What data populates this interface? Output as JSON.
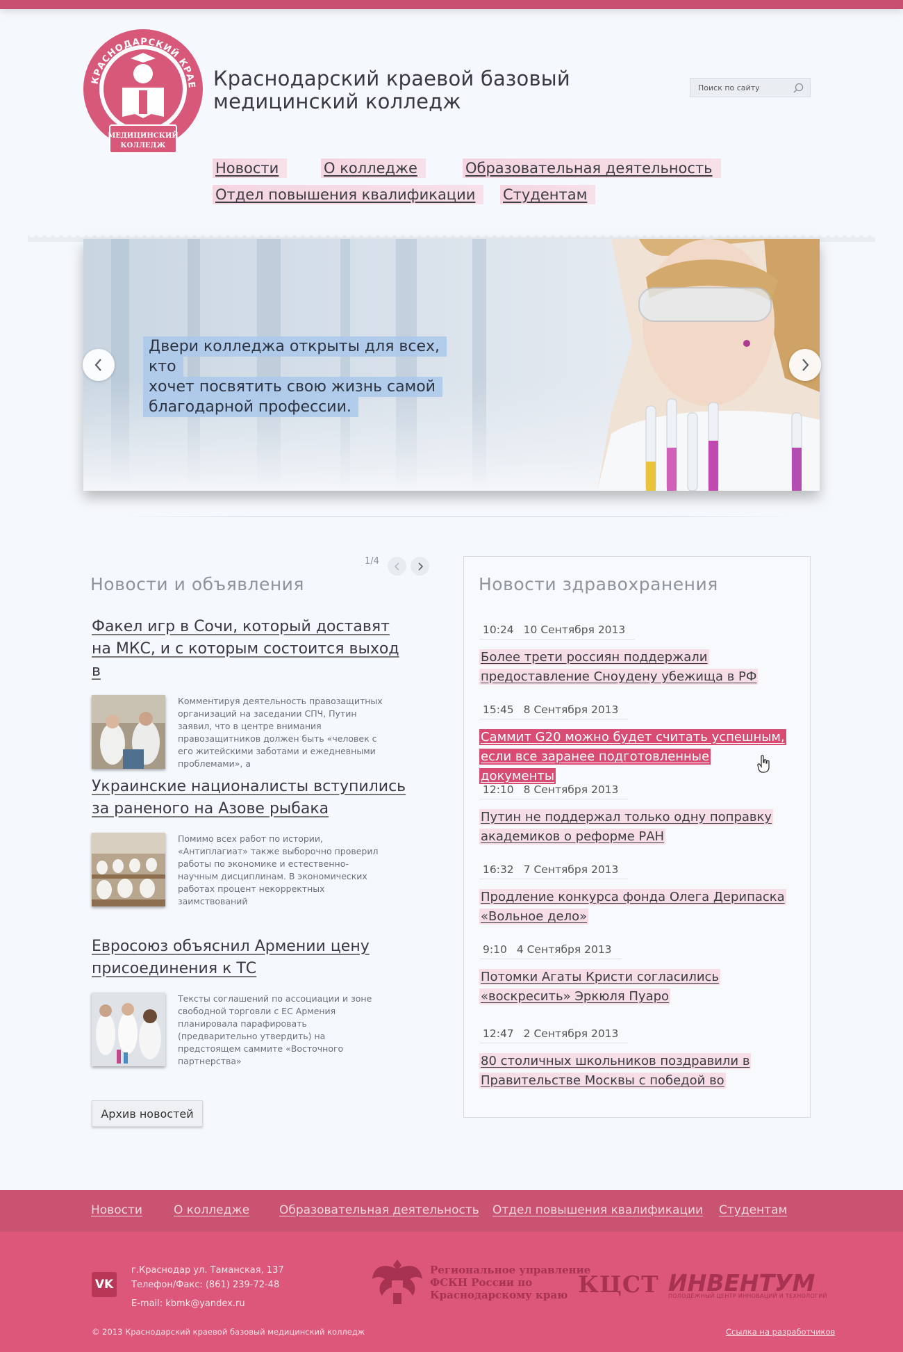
{
  "colors": {
    "accent": "#dc577a",
    "accent_dark": "#c95371",
    "highlight": "#f6dde6",
    "active": "#d84b72"
  },
  "header": {
    "title_line1": "Краснодарский краевой базовый",
    "title_line2": "медицинский колледж",
    "logo_ring_text": "КРАСНОДАРСКИЙ КРАЕВОЙ БАЗОВЫЙ",
    "logo_ribbon_line1": "МЕДИЦИНСКИЙ",
    "logo_ribbon_line2": "КОЛЛЕДЖ",
    "search_placeholder": "Поиск по сайту",
    "search_icon": "search-icon"
  },
  "nav": [
    "Новости",
    "О колледже",
    "Образовательная деятельность",
    "Отдел повышения квалификации",
    "Студентам"
  ],
  "slider": {
    "caption_line1": "Двери колледжа открыты для всех, кто",
    "caption_line2": "хочет посвятить свою жизнь самой",
    "caption_line3": "благодарной профессии.",
    "prev_icon": "chevron-left-icon",
    "next_icon": "chevron-right-icon"
  },
  "news": {
    "title": "Новости и объявления",
    "pager": "1/4",
    "items": [
      {
        "title": "Факел игр в Сочи, который доставят на МКС, и с которым состоится выход в",
        "text": "Комментируя деятельность правозащитных организаций на заседании СПЧ, Путин заявил, что в центре внимания правозащитников должен быть «человек с его житейскими заботами и ежедневными проблемами», а"
      },
      {
        "title": "Украинские националисты вступились за раненого на Азове рыбака",
        "text": "Помимо всех работ по истории, «Антиплагиат» также выборочно проверил работы по экономике и естественно-научным дисциплинам. В экономических работах процент некорректных заимствований"
      },
      {
        "title": "Евросоюз объяснил Армении цену присоединения к ТС",
        "text": "Тексты соглашений по ассоциации и зоне свободной торговли с ЕС Армения планировала парафировать (предварительно утвердить) на предстоящем саммите «Восточного партнерства»"
      }
    ],
    "archive_label": "Архив новостей"
  },
  "health": {
    "title": "Новости здравохранения",
    "items": [
      {
        "time": "10:24",
        "date": "10 Сентября 2013",
        "title": "Более трети россиян поддержали предоставление Сноудену убежища в РФ"
      },
      {
        "time": "15:45",
        "date": "8 Сентября 2013",
        "title": "Саммит G20 можно будет считать успешным, если все заранее подготовленные документы"
      },
      {
        "time": "12:10",
        "date": "8 Сентября 2013",
        "title": "Путин не поддержал только одну поправку академиков о реформе РАН"
      },
      {
        "time": "16:32",
        "date": "7 Сентября 2013",
        "title": "Продление конкурса фонда Олега Дерипаска «Вольное дело»"
      },
      {
        "time": "9:10",
        "date": "4 Сентября 2013",
        "title": "Потомки Агаты Кристи согласились «воскресить» Эркюля Пуаро"
      },
      {
        "time": "12:47",
        "date": "2 Сентября 2013",
        "title": "80 столичных школьников поздравили в Правительстве Москвы с победой во"
      }
    ]
  },
  "footer": {
    "nav": [
      "Новости",
      "О колледже",
      "Образовательная деятельность",
      "Отдел повышения квалификации",
      "Студентам"
    ],
    "vk_label": "VK",
    "address": "г.Краснодар ул. Таманская, 137",
    "phone": "Телефон/Факс: (861) 239-72-48",
    "email": "E-mail: kbmk@yandex.ru",
    "partner1_line1": "Региональное управление",
    "partner1_line2": "ФСКН России по",
    "partner1_line3": "Краснодарскому краю",
    "partner2": "КЦСТ",
    "partner3": "ИНВЕНТУМ",
    "partner3_sub": "ПОЛОДЁЖНЫЙ ЦЕНТР ИННОВАЦИЙ И ТЕХНОЛОГИЙ",
    "copyright": "© 2013  Краснодарский краевой базовый медицинский колледж",
    "dev_link": "Ссылка на разработчиков"
  }
}
